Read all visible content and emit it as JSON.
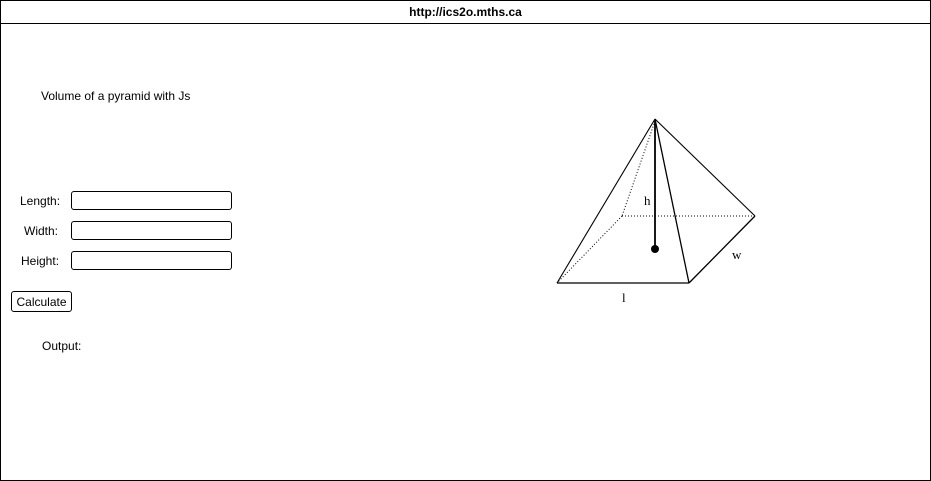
{
  "window": {
    "url": "http://ics2o.mths.ca"
  },
  "page": {
    "heading": "Volume of a pyramid with Js"
  },
  "form": {
    "length_label": "Length:",
    "width_label": "Width:",
    "height_label": "Height:",
    "length_value": "",
    "width_value": "",
    "height_value": "",
    "calculate_label": "Calculate"
  },
  "output": {
    "label": "Output:"
  },
  "diagram": {
    "height_label": "h",
    "width_label": "w",
    "length_label": "l"
  }
}
